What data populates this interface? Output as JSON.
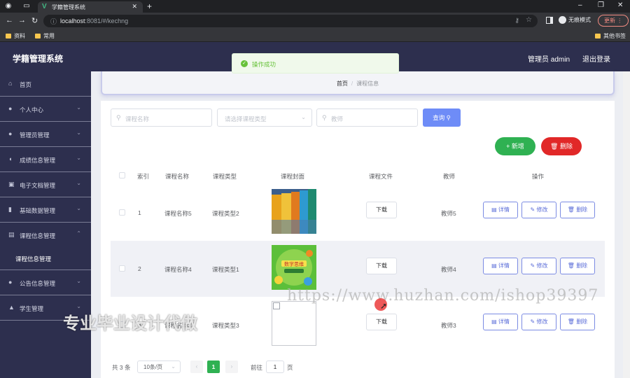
{
  "browser": {
    "tab_title": "学籍管理系统",
    "url_host": "localhost",
    "url_rest": ":8081/#/kechng",
    "incognito_label": "无痕模式",
    "update_label": "更新",
    "bookmarks": [
      "资料",
      "常用"
    ],
    "other_bookmarks": "其他书签"
  },
  "header": {
    "title": "学籍管理系统",
    "admin_label": "管理员 admin",
    "logout_label": "退出登录"
  },
  "sidebar": {
    "items": [
      {
        "label": "首页",
        "icon": "home-icon"
      },
      {
        "label": "个人中心",
        "icon": "user-icon"
      },
      {
        "label": "管理员管理",
        "icon": "bulb-icon"
      },
      {
        "label": "成绩信息管理",
        "icon": "mic-icon"
      },
      {
        "label": "电子文档管理",
        "icon": "doc-icon"
      },
      {
        "label": "基础数据管理",
        "icon": "chart-icon"
      },
      {
        "label": "课程信息管理",
        "icon": "course-icon"
      },
      {
        "label": "公告信息管理",
        "icon": "user-icon"
      },
      {
        "label": "学生管理",
        "icon": "student-icon"
      }
    ],
    "sub_item": "课程信息管理"
  },
  "breadcrumb": {
    "home": "首页",
    "separator": "/",
    "current": "课程信息"
  },
  "search": {
    "course_name_placeholder": "课程名称",
    "course_type_placeholder": "请选择课程类型",
    "teacher_placeholder": "教师",
    "query_label": "查询"
  },
  "actions": {
    "add_label": "新增",
    "delete_label": "删除"
  },
  "table": {
    "headers": [
      "索引",
      "课程名称",
      "课程类型",
      "课程封面",
      "课程文件",
      "教师",
      "操作"
    ],
    "rows": [
      {
        "index": "1",
        "name": "课程名称5",
        "type": "课程类型2",
        "download": "下载",
        "teacher": "教师5"
      },
      {
        "index": "2",
        "name": "课程名称4",
        "type": "课程类型1",
        "download": "下载",
        "teacher": "教师4"
      },
      {
        "index": "3",
        "name": "课程名称3",
        "type": "课程类型3",
        "download": "下载",
        "teacher": "教师3"
      }
    ],
    "op_labels": {
      "detail": "详情",
      "edit": "修改",
      "delete": "删除"
    },
    "cover_text_row2": "数学思维"
  },
  "pagination": {
    "total": "共 3 条",
    "page_size": "10条/页",
    "current_page": "1",
    "goto_prefix": "前往",
    "goto_value": "1",
    "goto_suffix": "页"
  },
  "toast": {
    "message": "操作成功"
  },
  "watermark": {
    "url": "https://www.huzhan.com/ishop39397",
    "text": "专业毕业设计代做"
  },
  "colors": {
    "sidebar_bg": "#2d2f4e",
    "primary": "#6e8cf7",
    "success": "#2fb152",
    "danger": "#e12828"
  }
}
